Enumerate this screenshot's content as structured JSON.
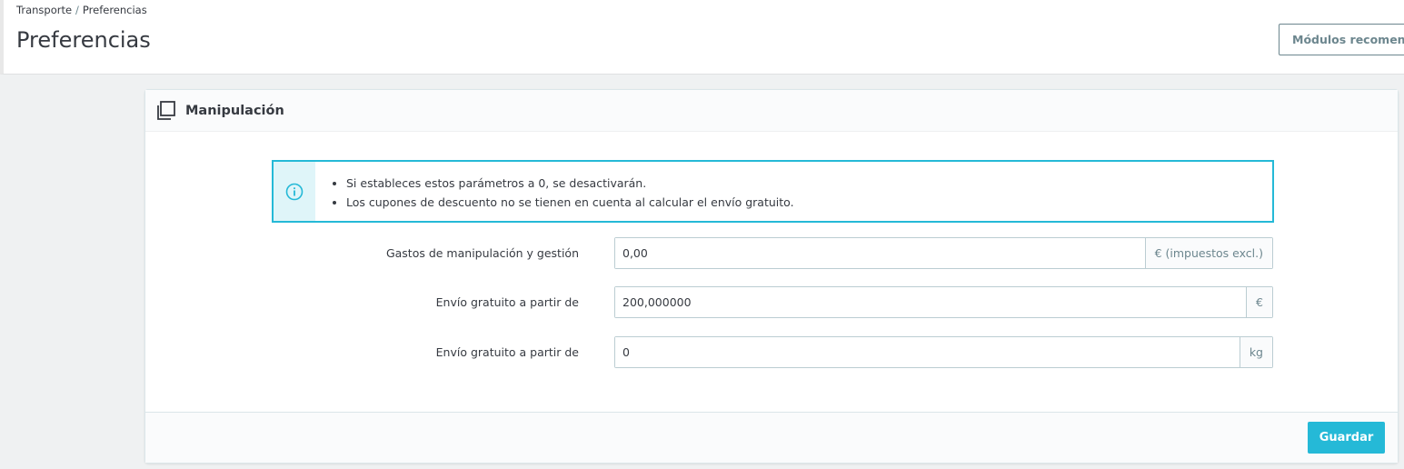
{
  "breadcrumb": {
    "parent": "Transporte",
    "separator": "/",
    "current": "Preferencias"
  },
  "page_title": "Preferencias",
  "toolbar": {
    "recommended_modules_label": "Módulos recomendados"
  },
  "panel": {
    "title": "Manipulación",
    "icon": "copy-icon",
    "alert": {
      "icon": "info-circle-icon",
      "items": [
        "Si estableces estos parámetros a 0, se desactivarán.",
        "Los cupones de descuento no se tienen en cuenta al calcular el envío gratuito."
      ]
    },
    "fields": [
      {
        "label": "Gastos de manipulación y gestión",
        "value": "0,00",
        "addon": "€ (impuestos excl.)"
      },
      {
        "label": "Envío gratuito a partir de",
        "value": "200,000000",
        "addon": "€"
      },
      {
        "label": "Envío gratuito a partir de",
        "value": "0",
        "addon": "kg"
      }
    ],
    "save_label": "Guardar"
  },
  "colors": {
    "accent": "#25b9d7",
    "text": "#363a41",
    "muted": "#6c868e"
  }
}
